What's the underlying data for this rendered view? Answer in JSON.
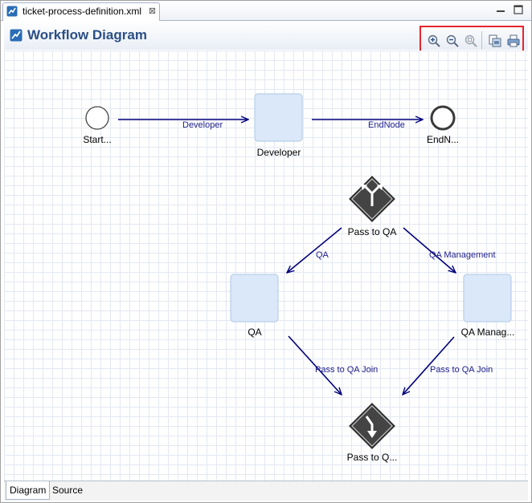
{
  "editor_tab": {
    "label": "ticket-process-definition.xml",
    "close_glyph": "⊠"
  },
  "header": {
    "title": "Workflow Diagram"
  },
  "toolbar": {
    "buttons": [
      "zoom-in-icon",
      "zoom-out-icon",
      "zoom-fit-icon",
      "export-image-icon",
      "print-icon"
    ]
  },
  "diagram": {
    "nodes": [
      {
        "id": "start",
        "type": "start-event",
        "label": "Start..."
      },
      {
        "id": "developer",
        "type": "task",
        "label": "Developer"
      },
      {
        "id": "end",
        "type": "end-event",
        "label": "EndN..."
      },
      {
        "id": "fork",
        "type": "fork-gateway",
        "label": "Pass to QA"
      },
      {
        "id": "qa",
        "type": "task",
        "label": "QA"
      },
      {
        "id": "qa_management",
        "type": "task",
        "label": "QA Manag..."
      },
      {
        "id": "join",
        "type": "join-gateway",
        "label": "Pass to Q..."
      }
    ],
    "edges": [
      {
        "from": "start",
        "to": "developer",
        "label": "Developer"
      },
      {
        "from": "developer",
        "to": "end",
        "label": "EndNode"
      },
      {
        "from": "fork",
        "to": "qa",
        "label": "QA"
      },
      {
        "from": "fork",
        "to": "qa_management",
        "label": "QA Management"
      },
      {
        "from": "qa",
        "to": "join",
        "label": "Pass to QA Join"
      },
      {
        "from": "qa_management",
        "to": "join",
        "label": "Pass to QA Join"
      }
    ]
  },
  "bottom_tabs": [
    {
      "label": "Diagram",
      "active": true
    },
    {
      "label": "Source",
      "active": false
    }
  ],
  "colors": {
    "accent": "#2a4f86",
    "edge": "#00007a",
    "task_fill": "#dbe8f9",
    "highlight": "#e4262d"
  }
}
